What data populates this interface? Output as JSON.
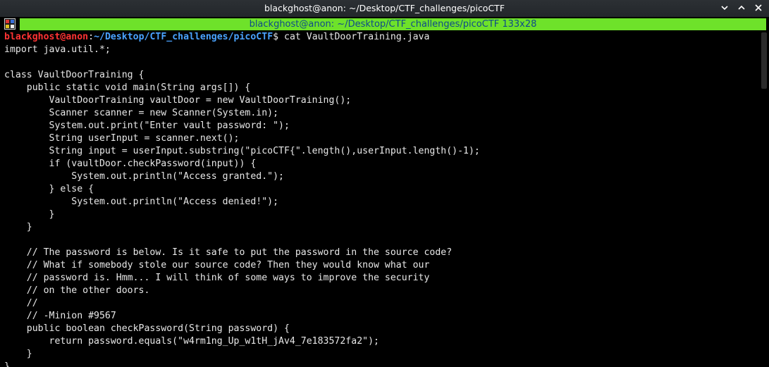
{
  "window": {
    "title": "blackghost@anon: ~/Desktop/CTF_challenges/picoCTF",
    "tab_label": "blackghost@anon: ~/Desktop/CTF_challenges/picoCTF 133x28",
    "controls": [
      "minimize-icon",
      "maximize-icon",
      "close-icon"
    ]
  },
  "prompt": {
    "user": "blackghost",
    "at": "@anon",
    "colon": ":",
    "path": "~/Desktop/CTF_challenges/picoCTF",
    "dollar": "$",
    "command": " cat VaultDoorTraining.java"
  },
  "output_lines": [
    "import java.util.*;",
    "",
    "class VaultDoorTraining {",
    "    public static void main(String args[]) {",
    "        VaultDoorTraining vaultDoor = new VaultDoorTraining();",
    "        Scanner scanner = new Scanner(System.in);",
    "        System.out.print(\"Enter vault password: \");",
    "        String userInput = scanner.next();",
    "        String input = userInput.substring(\"picoCTF{\".length(),userInput.length()-1);",
    "        if (vaultDoor.checkPassword(input)) {",
    "            System.out.println(\"Access granted.\");",
    "        } else {",
    "            System.out.println(\"Access denied!\");",
    "        }",
    "    }",
    "",
    "    // The password is below. Is it safe to put the password in the source code?",
    "    // What if somebody stole our source code? Then they would know what our",
    "    // password is. Hmm... I will think of some ways to improve the security",
    "    // on the other doors.",
    "    //",
    "    // -Minion #9567",
    "    public boolean checkPassword(String password) {",
    "        return password.equals(\"w4rm1ng_Up_w1tH_jAv4_7e183572fa2\");",
    "    }",
    "}"
  ]
}
